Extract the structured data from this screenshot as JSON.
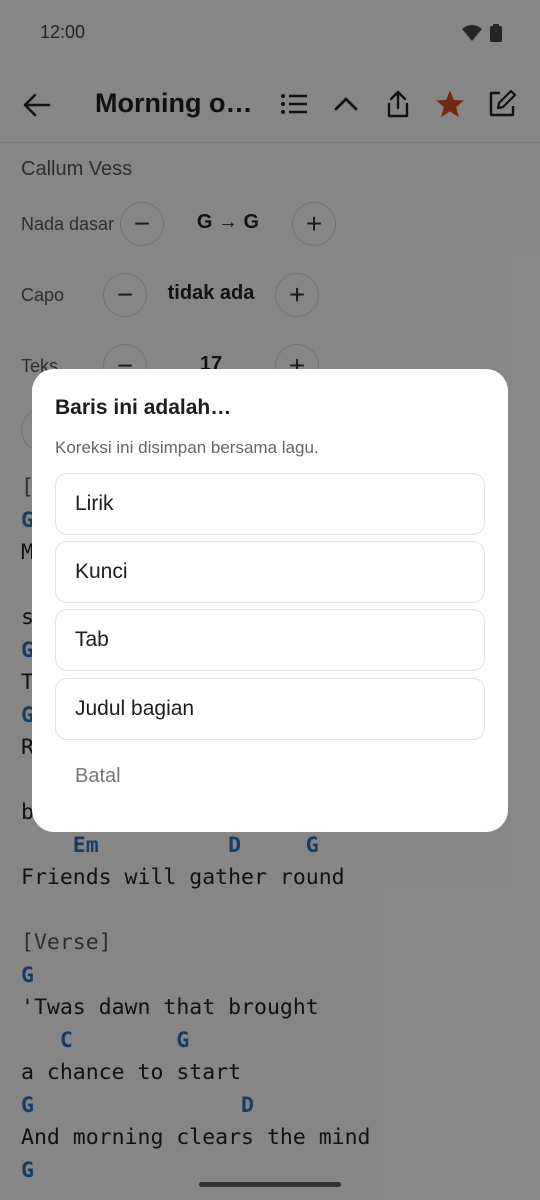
{
  "status_bar": {
    "time": "12:00"
  },
  "app_bar": {
    "title": "Morning on t…"
  },
  "artist": "Callum Vess",
  "controls": {
    "key": {
      "label": "Nada dasar",
      "value": "G → G"
    },
    "capo": {
      "label": "Capo",
      "value": "tidak ada"
    },
    "text": {
      "label": "Teks",
      "value": "17"
    },
    "minus": "−",
    "plus": "+"
  },
  "sheet_lines": [
    {
      "text": "[",
      "kind": "sec"
    },
    {
      "text": "G",
      "kind": "chord"
    },
    {
      "text": "M",
      "kind": "lyr"
    },
    {
      "text": "",
      "kind": "lyr"
    },
    {
      "text": "s",
      "kind": "lyr"
    },
    {
      "text": "G",
      "kind": "chord"
    },
    {
      "text": "T",
      "kind": "lyr"
    },
    {
      "text": "G",
      "kind": "chord"
    },
    {
      "text": "R",
      "kind": "lyr"
    },
    {
      "text": "",
      "kind": "lyr"
    },
    {
      "text": "b",
      "kind": "lyr"
    },
    {
      "text": "    Em          D     G",
      "kind": "chord"
    },
    {
      "text": "Friends will gather round",
      "kind": "lyr"
    },
    {
      "text": "",
      "kind": "lyr"
    },
    {
      "text": "[Verse]",
      "kind": "sec"
    },
    {
      "text": "G",
      "kind": "chord"
    },
    {
      "text": "'Twas dawn that brought",
      "kind": "lyr"
    },
    {
      "text": "   C        G",
      "kind": "chord"
    },
    {
      "text": "a chance to start",
      "kind": "lyr"
    },
    {
      "text": "G                D",
      "kind": "chord"
    },
    {
      "text": "And morning clears the mind",
      "kind": "lyr"
    },
    {
      "text": "G",
      "kind": "chord"
    }
  ],
  "dialog": {
    "title": "Baris ini adalah…",
    "subtitle": "Koreksi ini disimpan bersama lagu.",
    "options": [
      "Lirik",
      "Kunci",
      "Tab",
      "Judul bagian"
    ],
    "cancel": "Batal"
  },
  "colors": {
    "chord": "#2a6fb3",
    "star": "#d14a1f",
    "scrim": "rgba(0,0,0,0.45)"
  },
  "icons": [
    "wifi-icon",
    "battery-icon",
    "back-arrow-icon",
    "list-icon",
    "chevron-up-icon",
    "share-icon",
    "star-icon",
    "edit-icon"
  ]
}
